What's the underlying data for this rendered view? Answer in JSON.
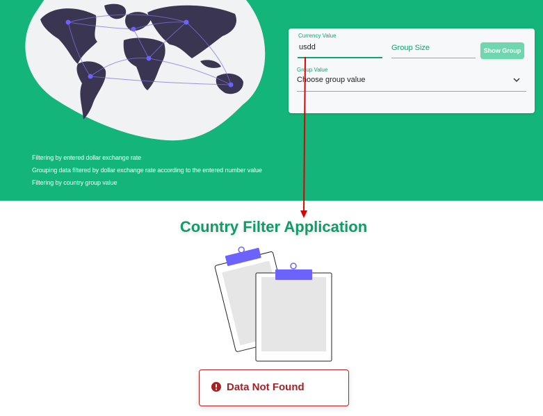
{
  "hero": {
    "features": [
      "Filtering by entered dollar exchange rate",
      "Grouping data filtered by dollar exchange rate according to the entered number value",
      "Filtering by country group value"
    ]
  },
  "filter_form": {
    "currency": {
      "label": "Currency Value",
      "value": "usdd"
    },
    "group_size": {
      "placeholder": "Group Size"
    },
    "show_group_label": "Show Group",
    "group_value": {
      "label": "Group Value",
      "selected": "Choose group value"
    }
  },
  "main": {
    "title": "Country Filter Application",
    "error_message": "Data Not Found"
  },
  "colors": {
    "brand_green": "#13b57a",
    "title_green": "#119a6a",
    "error_red": "#a82020",
    "annotation_arrow": "#e00000",
    "illustration_accent": "#6c63ff"
  },
  "icons": [
    "world-map-illustration",
    "clipboard-illustration",
    "chevron-down-icon",
    "error-icon"
  ]
}
